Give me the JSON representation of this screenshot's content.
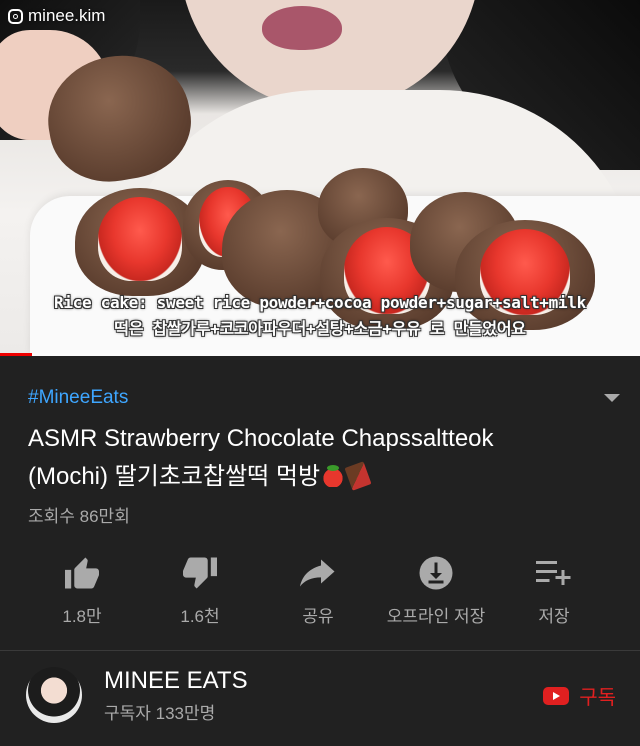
{
  "video": {
    "watermark": "minee.kim",
    "subtitle_en": "Rice cake: sweet rice powder+cocoa powder+sugar+salt+milk",
    "subtitle_ko": "떡은 찹쌀가루+코코아파우더+설탕+소금+우유 로 만들었어요",
    "progress_fraction": 0.05
  },
  "info": {
    "hashtag": "#MineeEats",
    "title_line1": "ASMR Strawberry Chocolate Chapssaltteok",
    "title_line2": "(Mochi) 딸기초코찹쌀떡 먹방",
    "views": "조회수 86만회"
  },
  "actions": [
    {
      "icon": "thumbs-up-icon",
      "label": "1.8만"
    },
    {
      "icon": "thumbs-down-icon",
      "label": "1.6천"
    },
    {
      "icon": "share-icon",
      "label": "공유"
    },
    {
      "icon": "download-icon",
      "label": "오프라인 저장"
    },
    {
      "icon": "add-to-playlist-icon",
      "label": "저장"
    }
  ],
  "channel": {
    "name": "MINEE EATS",
    "subscribers": "구독자 133만명",
    "subscribe_label": "구독"
  },
  "colors": {
    "background": "#212121",
    "hashtag": "#3ea6ff",
    "subscribe": "#e02020",
    "progress": "#ee0000"
  }
}
